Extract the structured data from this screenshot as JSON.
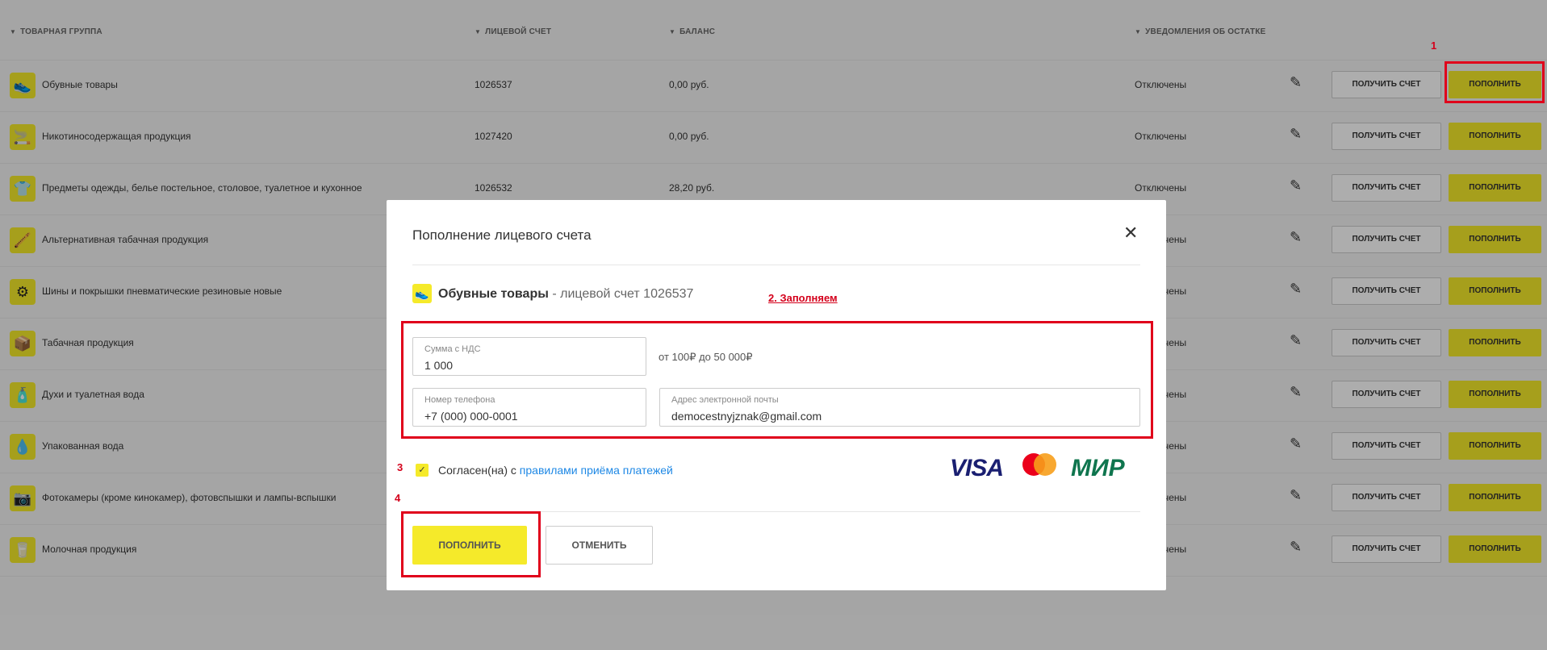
{
  "table": {
    "headers": {
      "group": "ТОВАРНАЯ ГРУППА",
      "account": "ЛИЦЕВОЙ СЧЕТ",
      "balance": "БАЛАНС",
      "notifications": "УВЕДОМЛЕНИЯ ОБ ОСТАТКЕ"
    },
    "invoice_label": "ПОЛУЧИТЬ СЧЕТ",
    "topup_label": "ПОПОЛНИТЬ",
    "rows": [
      {
        "icon": "shoe-icon",
        "glyph": "👟",
        "name": "Обувные товары",
        "account": "1026537",
        "balance": "0,00 руб.",
        "notifications": "Отключены"
      },
      {
        "icon": "nicotine-icon",
        "glyph": "🚬",
        "name": "Никотиносодержащая продукция",
        "account": "1027420",
        "balance": "0,00 руб.",
        "notifications": "Отключены"
      },
      {
        "icon": "clothes-icon",
        "glyph": "👕",
        "name": "Предметы одежды, белье постельное, столовое, туалетное и кухонное",
        "account": "1026532",
        "balance": "28,20 руб.",
        "notifications": "Отключены"
      },
      {
        "icon": "pipe-icon",
        "glyph": "🪈",
        "name": "Альтернативная табачная продукция",
        "account": "",
        "balance": "",
        "notifications": "Отключены"
      },
      {
        "icon": "tire-icon",
        "glyph": "⚙",
        "name": "Шины и покрышки пневматические резиновые новые",
        "account": "",
        "balance": "",
        "notifications": "Отключены"
      },
      {
        "icon": "tobacco-icon",
        "glyph": "📦",
        "name": "Табачная продукция",
        "account": "",
        "balance": "",
        "notifications": "Отключены"
      },
      {
        "icon": "perfume-icon",
        "glyph": "🧴",
        "name": "Духи и туалетная вода",
        "account": "",
        "balance": "",
        "notifications": "Отключены"
      },
      {
        "icon": "water-icon",
        "glyph": "💧",
        "name": "Упакованная вода",
        "account": "",
        "balance": "",
        "notifications": "Отключены"
      },
      {
        "icon": "camera-icon",
        "glyph": "📷",
        "name": "Фотокамеры (кроме кинокамер), фотовспышки и лампы-вспышки",
        "account": "",
        "balance": "",
        "notifications": "Отключены"
      },
      {
        "icon": "milk-icon",
        "glyph": "🥛",
        "name": "Молочная продукция",
        "account": "",
        "balance": "",
        "notifications": "Отключены"
      }
    ]
  },
  "modal": {
    "title": "Пополнение лицевого счета",
    "product_name": "Обувные товары",
    "product_suffix": " - лицевой счет 1026537",
    "amount_label": "Сумма с НДС",
    "amount_value": "1 000",
    "amount_range": "от 100₽ до 50 000₽",
    "phone_label": "Номер телефона",
    "phone_value": "+7 (000) 000-0001",
    "email_label": "Адрес электронной почты",
    "email_value": "democestnyjznak@gmail.com",
    "agree_prefix": "Согласен(на) с ",
    "agree_link": "правилами приёма платежей",
    "card_visa": "VISA",
    "card_mir": "МИР",
    "submit_label": "ПОПОЛНИТЬ",
    "cancel_label": "ОТМЕНИТЬ"
  },
  "annotations": {
    "step1": "1",
    "step2": "2. Заполняем",
    "step3": "3",
    "step4": "4"
  },
  "colors": {
    "accent_yellow": "#f5ea2a",
    "annotation_red": "#e0001b",
    "link_blue": "#1e88e5"
  }
}
